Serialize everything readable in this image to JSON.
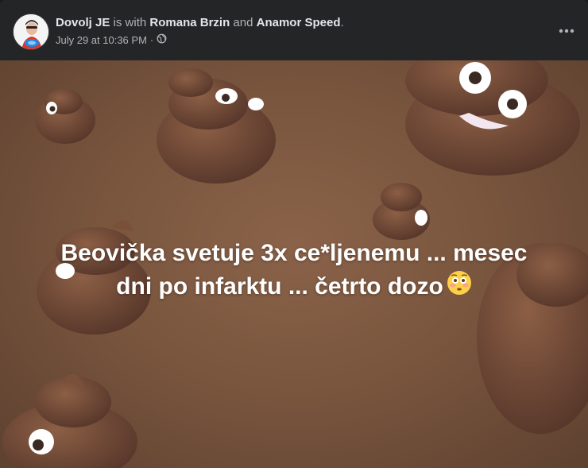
{
  "post": {
    "author": "Dovolj JE",
    "with_text": "is with",
    "tagged_1": "Romana Brzin",
    "and_text": "and",
    "tagged_2": "Anamor Speed",
    "period": ".",
    "timestamp": "July 29 at 10:36 PM",
    "dot": "·",
    "privacy_icon": "globe-icon",
    "more_icon": "more-options-icon"
  },
  "image": {
    "line1": "Beovička svetuje 3x ce*ljenemu ... mesec",
    "line2": "dni po infarktu ... četrto dozo",
    "emoji": "flushed-face-emoji"
  },
  "colors": {
    "header_bg": "#242526",
    "text_primary": "#e4e6eb",
    "text_secondary": "#b0b3b8",
    "image_bg": "#7a563e",
    "poop": "#6b4632"
  }
}
